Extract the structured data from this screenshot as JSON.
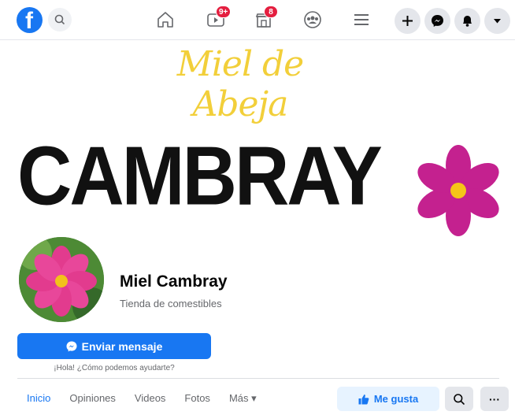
{
  "nav": {
    "logo_letter": "f",
    "video_badge": "9+",
    "marketplace_badge": "8",
    "icons": [
      "search-icon",
      "home-icon",
      "watch-icon",
      "marketplace-icon",
      "groups-icon",
      "menu-icon",
      "plus-icon",
      "messenger-icon",
      "notifications-icon",
      "chevron-down-icon"
    ]
  },
  "cover": {
    "script_title": "Miel de Abeja",
    "brand": "CAMBRAY"
  },
  "profile": {
    "name": "Miel Cambray",
    "category": "Tienda de comestibles"
  },
  "actions": {
    "message_label": "Enviar mensaje",
    "message_hint": "¡Hola! ¿Cómo podemos ayudarte?",
    "like_label": "Me gusta",
    "more_label": "···"
  },
  "tabs": [
    {
      "label": "Inicio",
      "active": true
    },
    {
      "label": "Opiniones"
    },
    {
      "label": "Videos"
    },
    {
      "label": "Fotos"
    },
    {
      "label": "Más ▾"
    }
  ],
  "colors": {
    "brand_blue": "#1877f2",
    "badge_red": "#e41e3f",
    "honey_yellow": "#f2cf3a",
    "flower_magenta": "#c4218f"
  }
}
